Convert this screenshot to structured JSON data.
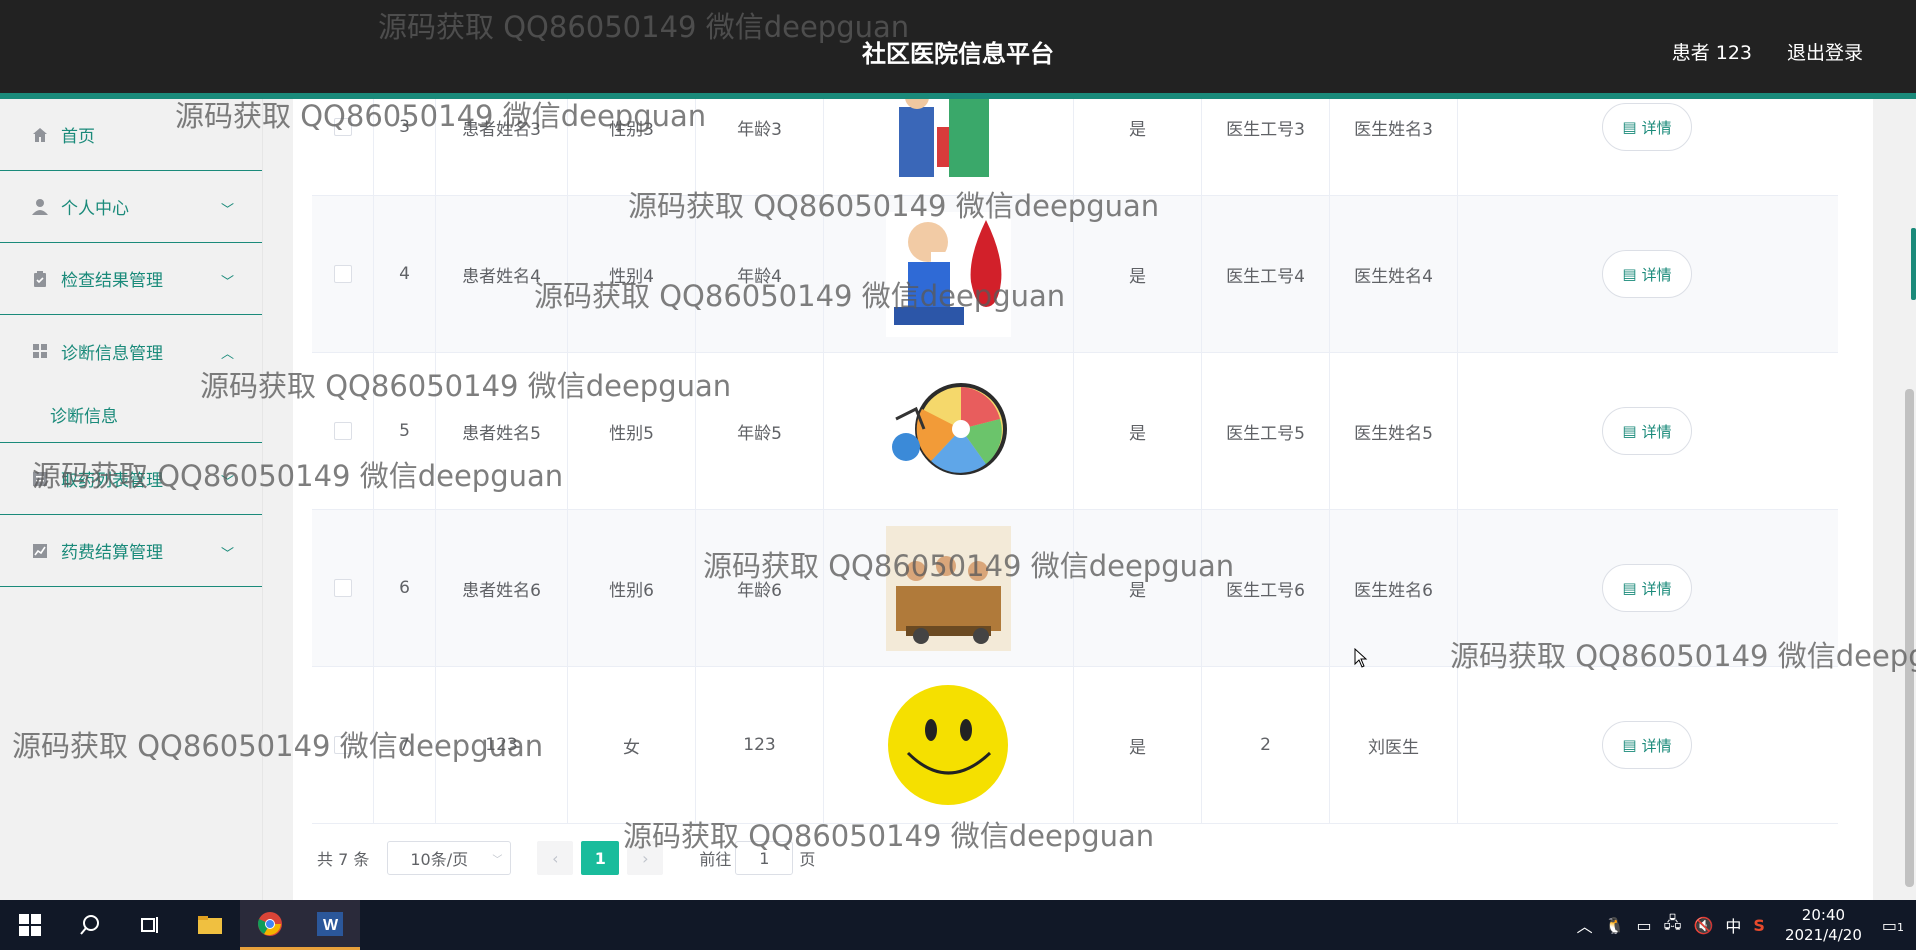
{
  "header": {
    "title": "社区医院信息平台",
    "user": "患者 123",
    "logout": "退出登录"
  },
  "sidebar": {
    "items": [
      {
        "label": "首页",
        "icon": "home-icon",
        "expandable": false
      },
      {
        "label": "个人中心",
        "icon": "user-icon",
        "expandable": true
      },
      {
        "label": "检查结果管理",
        "icon": "clipboard-icon",
        "expandable": true
      },
      {
        "label": "诊断信息管理",
        "icon": "grid-icon",
        "expandable": true,
        "expanded": true
      },
      {
        "label": "取药列表管理",
        "icon": "list-icon",
        "expandable": true
      },
      {
        "label": "药费结算管理",
        "icon": "chart-icon",
        "expandable": true
      }
    ],
    "submenu": {
      "label": "诊断信息"
    }
  },
  "table": {
    "rows": [
      {
        "id": "3",
        "name": "患者姓名3",
        "gender": "性别3",
        "age": "年龄3",
        "image": "doctors-illustration",
        "flag": "是",
        "doc_no": "医生工号3",
        "doc_name": "医生姓名3",
        "action": "详情"
      },
      {
        "id": "4",
        "name": "患者姓名4",
        "gender": "性别4",
        "age": "年龄4",
        "image": "diabetes-illustration",
        "flag": "是",
        "doc_no": "医生工号4",
        "doc_name": "医生姓名4",
        "action": "详情"
      },
      {
        "id": "5",
        "name": "患者姓名5",
        "gender": "性别5",
        "age": "年龄5",
        "image": "wheel-illustration",
        "flag": "是",
        "doc_no": "医生工号5",
        "doc_name": "医生姓名5",
        "action": "详情"
      },
      {
        "id": "6",
        "name": "患者姓名6",
        "gender": "性别6",
        "age": "年龄6",
        "image": "crowd-illustration",
        "flag": "是",
        "doc_no": "医生工号6",
        "doc_name": "医生姓名6",
        "action": "详情"
      },
      {
        "id": "7",
        "name": "123",
        "gender": "女",
        "age": "123",
        "image": "smiley-face",
        "flag": "是",
        "doc_no": "2",
        "doc_name": "刘医生",
        "action": "详情"
      }
    ]
  },
  "pagination": {
    "total": "共 7 条",
    "page_size": "10条/页",
    "current": "1",
    "goto_label": "前往",
    "goto_value": "1",
    "page_suffix": "页"
  },
  "watermark": "源码获取 QQ86050149 微信deepguan",
  "taskbar": {
    "time": "20:40",
    "date": "2021/4/20",
    "ime": "中",
    "notifications": "1"
  },
  "colors": {
    "accent": "#1a8a7a",
    "header_bg": "#222222",
    "page_active": "#1abc9c"
  }
}
